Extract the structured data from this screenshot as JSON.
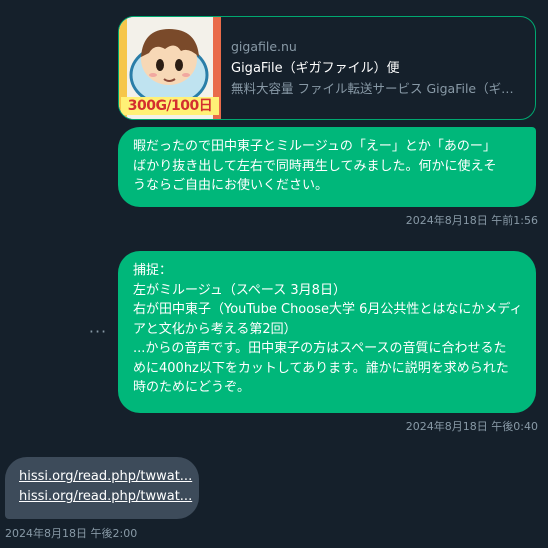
{
  "link_card": {
    "domain": "gigafile.nu",
    "title": "GigaFile（ギガファイル）便",
    "description": "無料大容量 ファイル転送サービス GigaFile（ギ…",
    "thumbnail_label": "300G/100日"
  },
  "messages": [
    {
      "lines": [
        "暇だったので田中東子とミルージュの「えー」とか「あのー」",
        "ばかり抜き出して左右で同時再生してみました。何かに使えそ",
        "うならご自由にお使いください。"
      ],
      "timestamp": "2024年8月18日 午前1:56"
    },
    {
      "lines": [
        "捕捉：",
        "左がミルージュ（スペース 3月8日）",
        "右が田中東子（YouTube Choose大学 6月公共性とはなにかメディ",
        "アと文化から考える第2回）",
        "...からの音声です。田中東子の方はスペースの音質に合わせるた",
        "めに400hz以下をカットしてあります。誰かに説明を求められた",
        "時のためにどうぞ。"
      ],
      "timestamp": "2024年8月18日 午後0:40"
    }
  ],
  "more_icon": "more-horizontal-icon",
  "received": {
    "links": [
      "hissi.org/read.php/twwat...",
      "hissi.org/read.php/twwat..."
    ],
    "timestamp": "2024年8月18日 午後2:00"
  },
  "colors": {
    "background": "#15202b",
    "sent_bubble": "#00b77a",
    "received_bubble": "#3d4b5a",
    "muted_text": "#8899a6",
    "card_border": "#00a870"
  }
}
